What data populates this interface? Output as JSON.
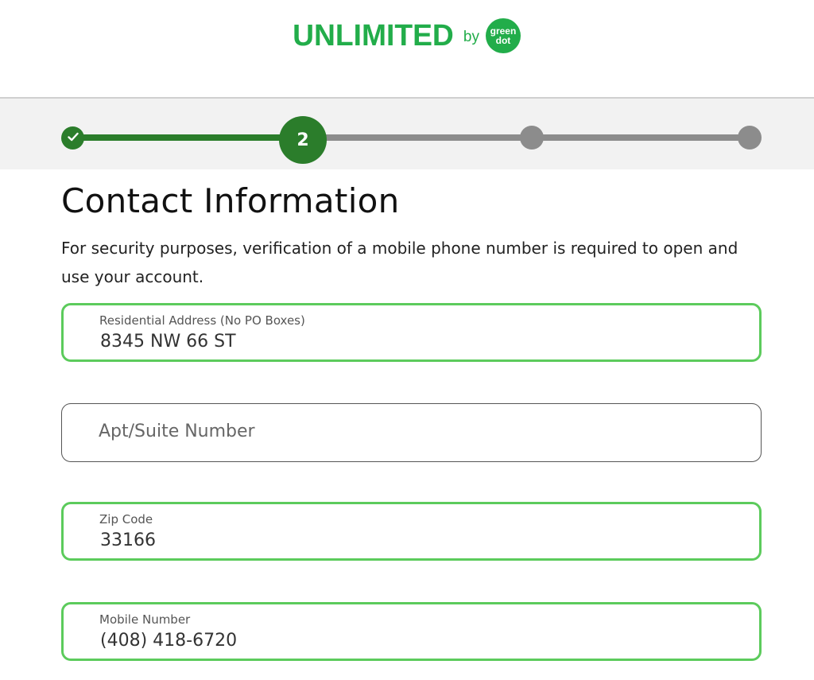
{
  "brand": {
    "name": "UNLIMITED",
    "by": "by",
    "badge_line1": "green",
    "badge_line2": "dot",
    "color": "#22ad4a"
  },
  "progress": {
    "current_step": 2,
    "current_label": "2",
    "total_steps": 4,
    "completed_icon": "checkmark-icon",
    "color_done": "#2b7d2b",
    "color_todo": "#8c8c8c"
  },
  "page": {
    "title": "Contact Information",
    "subtitle": "For security purposes, verification of a mobile phone number is required to open and use your account."
  },
  "form": {
    "address": {
      "label": "Residential Address (No PO Boxes)",
      "value": "8345 NW 66 ST"
    },
    "apt": {
      "placeholder": "Apt/Suite Number"
    },
    "zip": {
      "label": "Zip Code",
      "value": "33166"
    },
    "mobile": {
      "label": "Mobile Number",
      "value": "(408) 418-6720"
    }
  },
  "colors": {
    "valid_border": "#5ccb5c",
    "empty_border": "#555555"
  }
}
